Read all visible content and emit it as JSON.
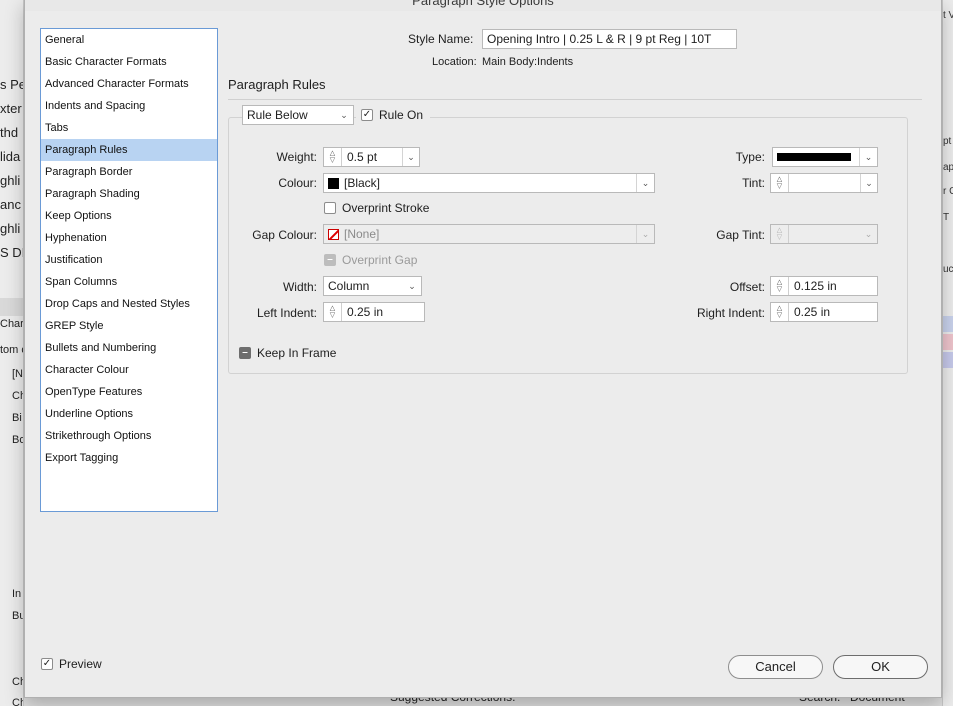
{
  "window": {
    "title": "Paragraph Style Options"
  },
  "background": {
    "left_fragments": [
      "s Pe",
      "xter",
      "thd",
      "lida",
      "ghli",
      "anc",
      "ghli",
      "S DI",
      "Chara",
      "tom c",
      "[N",
      "Ch",
      "Bi",
      "Bo",
      "In",
      "Bu",
      "Ch",
      "Checkbox"
    ],
    "right_fragments": [
      "t V",
      "pt",
      "aph",
      "r C",
      "T",
      "uc"
    ],
    "bottom_fragments": [
      "Suggested Corrections:",
      "Search:",
      "Document"
    ],
    "swatch_colors": [
      "#c9d2ec",
      "#eec4cc",
      "#c6c9ea"
    ]
  },
  "sidebar": {
    "selected_index": 5,
    "items": [
      "General",
      "Basic Character Formats",
      "Advanced Character Formats",
      "Indents and Spacing",
      "Tabs",
      "Paragraph Rules",
      "Paragraph Border",
      "Paragraph Shading",
      "Keep Options",
      "Hyphenation",
      "Justification",
      "Span Columns",
      "Drop Caps and Nested Styles",
      "GREP Style",
      "Bullets and Numbering",
      "Character Colour",
      "OpenType Features",
      "Underline Options",
      "Strikethrough Options",
      "Export Tagging"
    ]
  },
  "header": {
    "style_name_label": "Style Name:",
    "style_name_value": "Opening Intro | 0.25 L & R | 9 pt Reg | 10T",
    "location_label": "Location:",
    "location_value": "Main Body:Indents"
  },
  "section_title": "Paragraph Rules",
  "rule": {
    "position_value": "Rule Below",
    "rule_on_label": "Rule On",
    "rule_on_checked": true
  },
  "fields": {
    "weight_label": "Weight:",
    "weight_value": "0.5 pt",
    "type_label": "Type:",
    "colour_label": "Colour:",
    "colour_value": "[Black]",
    "tint_label": "Tint:",
    "tint_value": "",
    "overprint_stroke_label": "Overprint Stroke",
    "gap_colour_label": "Gap Colour:",
    "gap_colour_value": "[None]",
    "gap_tint_label": "Gap Tint:",
    "overprint_gap_label": "Overprint Gap",
    "width_label": "Width:",
    "width_value": "Column",
    "offset_label": "Offset:",
    "offset_value": "0.125 in",
    "left_indent_label": "Left Indent:",
    "left_indent_value": "0.25 in",
    "right_indent_label": "Right Indent:",
    "right_indent_value": "0.25 in",
    "keep_in_frame_label": "Keep In Frame"
  },
  "footer": {
    "preview_label": "Preview",
    "preview_checked": true,
    "cancel_label": "Cancel",
    "ok_label": "OK"
  },
  "colors": {
    "selection": "#b8d3f2",
    "sidebar_border": "#6a9ad6",
    "dialog_bg": "#ececec"
  }
}
